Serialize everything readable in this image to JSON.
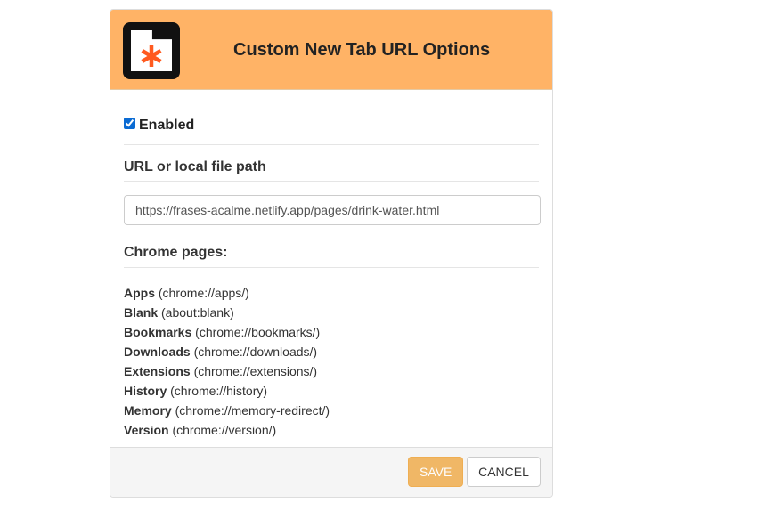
{
  "header": {
    "title": "Custom New Tab URL Options",
    "logo_icon": "new-tab-asterisk-icon",
    "background_color": "#ffb366"
  },
  "enabled": {
    "label": "Enabled",
    "checked": true
  },
  "url_section": {
    "title": "URL or local file path",
    "value": "https://frases-acalme.netlify.app/pages/drink-water.html"
  },
  "chrome_pages": {
    "title": "Chrome pages:",
    "items": [
      {
        "name": "Apps",
        "url": "(chrome://apps/)"
      },
      {
        "name": "Blank",
        "url": "(about:blank)"
      },
      {
        "name": "Bookmarks",
        "url": "(chrome://bookmarks/)"
      },
      {
        "name": "Downloads",
        "url": "(chrome://downloads/)"
      },
      {
        "name": "Extensions",
        "url": "(chrome://extensions/)"
      },
      {
        "name": "History",
        "url": "(chrome://history)"
      },
      {
        "name": "Memory",
        "url": "(chrome://memory-redirect/)"
      },
      {
        "name": "Version",
        "url": "(chrome://version/)"
      }
    ]
  },
  "footer": {
    "save_label": "SAVE",
    "cancel_label": "CANCEL",
    "save_color": "#f0ad4e"
  }
}
